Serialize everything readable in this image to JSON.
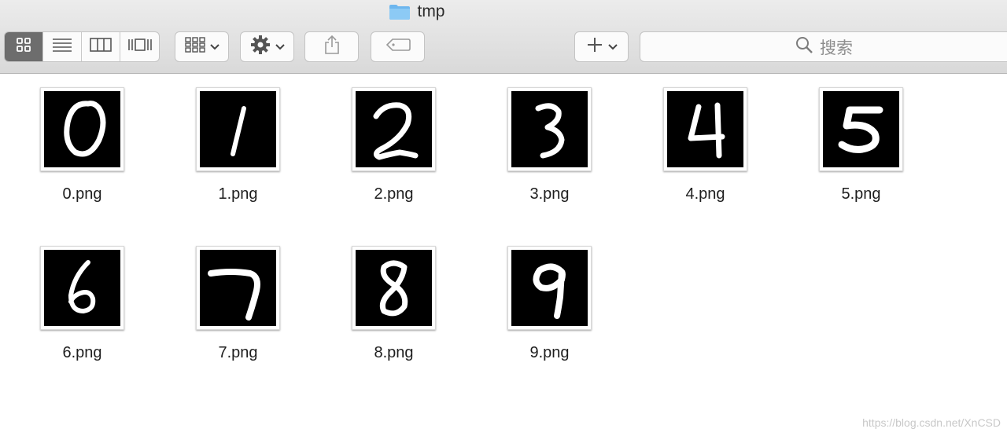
{
  "window": {
    "title": "tmp",
    "folder_color": "#6db6ee"
  },
  "toolbar": {
    "view_modes": [
      "icon-view",
      "list-view",
      "column-view",
      "cover-flow-view"
    ],
    "active_view": "icon-view",
    "search_placeholder": "搜索"
  },
  "files": [
    {
      "name": "0.png",
      "digit": "0"
    },
    {
      "name": "1.png",
      "digit": "1"
    },
    {
      "name": "2.png",
      "digit": "2"
    },
    {
      "name": "3.png",
      "digit": "3"
    },
    {
      "name": "4.png",
      "digit": "4"
    },
    {
      "name": "5.png",
      "digit": "5"
    },
    {
      "name": "6.png",
      "digit": "6"
    },
    {
      "name": "7.png",
      "digit": "7"
    },
    {
      "name": "8.png",
      "digit": "8"
    },
    {
      "name": "9.png",
      "digit": "9"
    }
  ],
  "watermark": "https://blog.csdn.net/XnCSD"
}
